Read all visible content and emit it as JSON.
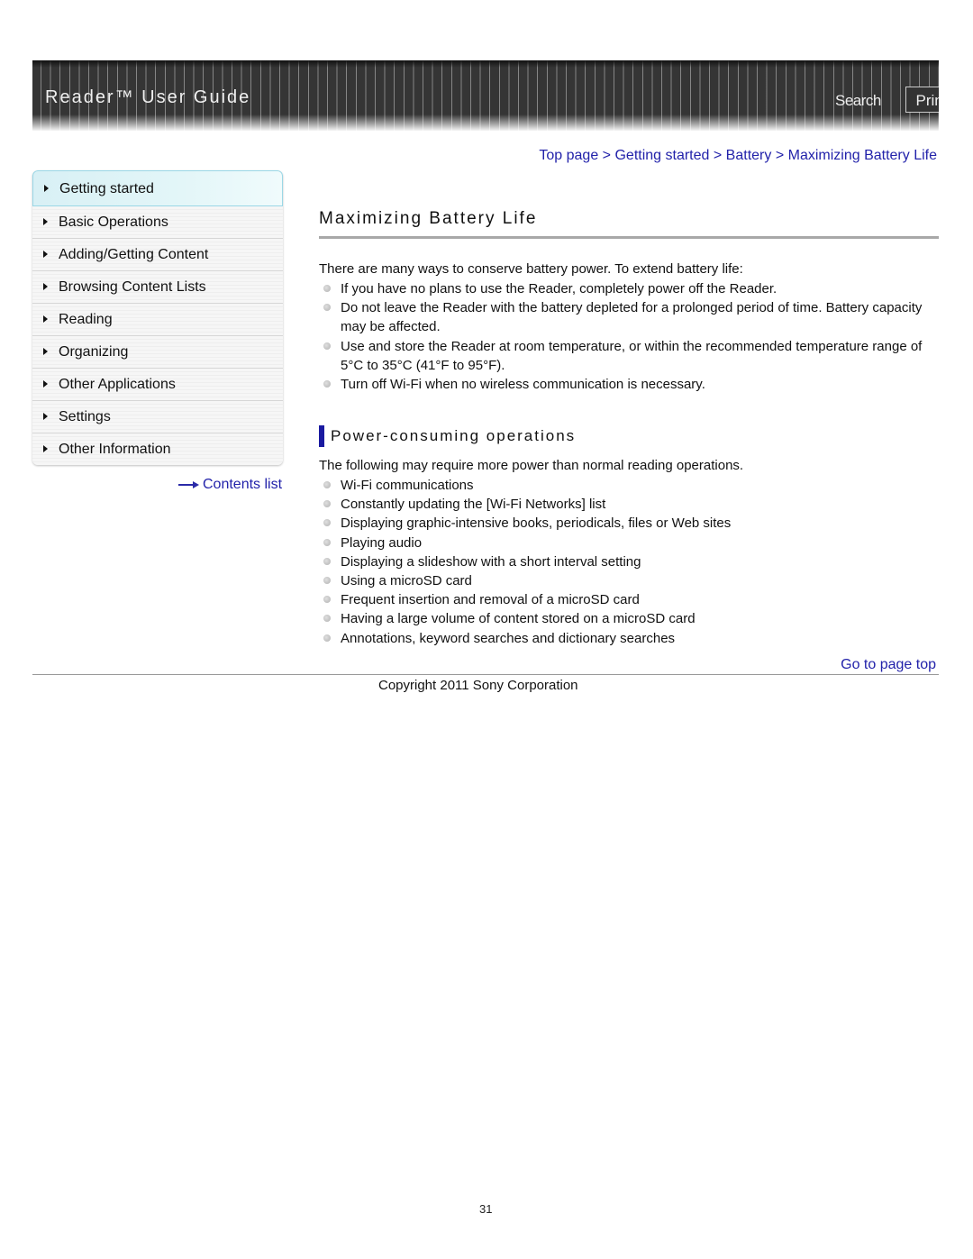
{
  "header": {
    "title": "Reader™ User Guide",
    "search_label": "Search",
    "print_label": "Print"
  },
  "sidebar": {
    "items": [
      {
        "label": "Getting started",
        "active": true
      },
      {
        "label": "Basic Operations"
      },
      {
        "label": "Adding/Getting Content"
      },
      {
        "label": "Browsing Content Lists"
      },
      {
        "label": "Reading"
      },
      {
        "label": "Organizing"
      },
      {
        "label": "Other Applications"
      },
      {
        "label": "Settings"
      },
      {
        "label": "Other Information"
      }
    ],
    "contents_link": "Contents list"
  },
  "breadcrumb": {
    "items": [
      "Top page",
      "Getting started",
      "Battery",
      "Maximizing Battery Life"
    ],
    "separator": ">"
  },
  "main": {
    "title": "Maximizing Battery Life",
    "intro": "There are many ways to conserve battery power. To extend battery life:",
    "tips": [
      "If you have no plans to use the Reader, completely power off the Reader.",
      "Do not leave the Reader with the battery depleted for a prolonged period of time. Battery capacity may be affected.",
      "Use and store the Reader at room temperature, or within the recommended temperature range of 5°C to 35°C (41°F to 95°F).",
      "Turn off Wi-Fi when no wireless communication is necessary."
    ],
    "section": {
      "heading": "Power-consuming operations",
      "intro": "The following may require more power than normal reading operations.",
      "items": [
        "Wi-Fi communications",
        "Constantly updating the [Wi-Fi Networks] list",
        "Displaying graphic-intensive books, periodicals, files or Web sites",
        "Playing audio",
        "Displaying a slideshow with a short interval setting",
        "Using a microSD card",
        "Frequent insertion and removal of a microSD card",
        "Having a large volume of content stored on a microSD card",
        "Annotations, keyword searches and dictionary searches"
      ]
    }
  },
  "footer": {
    "go_top": "Go to page top",
    "copyright": "Copyright 2011 Sony Corporation",
    "page_number": "31"
  },
  "colors": {
    "link": "#2222aa",
    "accent_bar": "#1a1aa0",
    "banner": "#353535"
  }
}
